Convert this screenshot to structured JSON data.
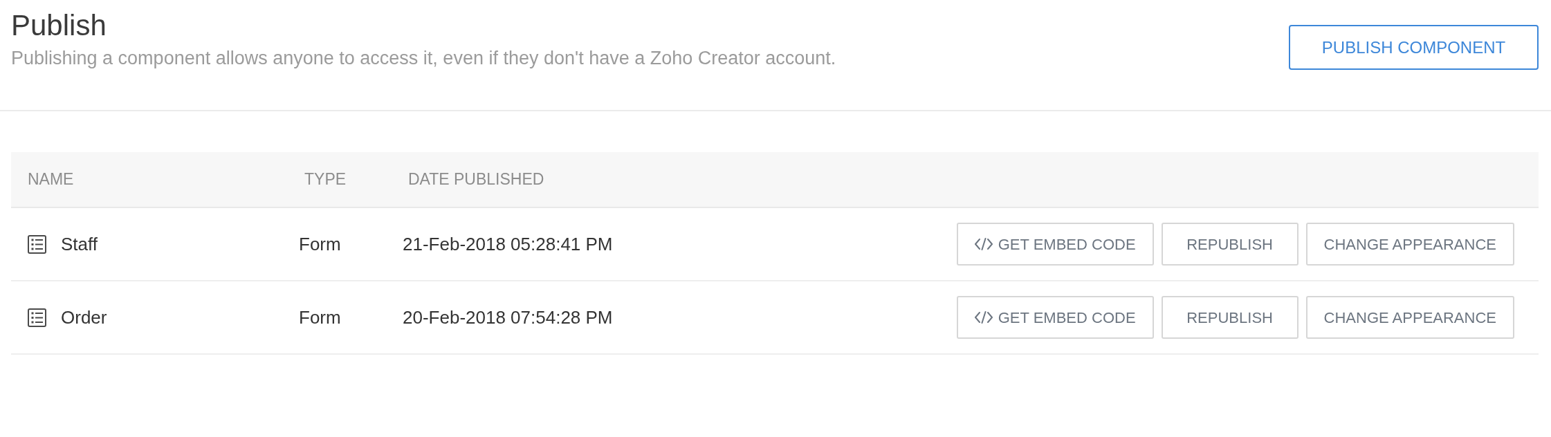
{
  "header": {
    "title": "Publish",
    "description": "Publishing a component allows anyone to access it, even if they don't have a Zoho Creator account.",
    "primary_button": "PUBLISH COMPONENT"
  },
  "table": {
    "columns": [
      "NAME",
      "TYPE",
      "DATE PUBLISHED"
    ],
    "rows": [
      {
        "name": "Staff",
        "type": "Form",
        "date_published": "21-Feb-2018 05:28:41 PM",
        "actions": [
          {
            "kind": "embed",
            "label": "GET EMBED CODE"
          },
          {
            "kind": "plain",
            "label": "REPUBLISH"
          },
          {
            "kind": "plain",
            "label": "CHANGE APPEARANCE"
          }
        ]
      },
      {
        "name": "Order",
        "type": "Form",
        "date_published": "20-Feb-2018 07:54:28 PM",
        "actions": [
          {
            "kind": "embed",
            "label": "GET EMBED CODE"
          },
          {
            "kind": "plain",
            "label": "REPUBLISH"
          },
          {
            "kind": "plain",
            "label": "CHANGE APPEARANCE"
          }
        ]
      }
    ]
  }
}
